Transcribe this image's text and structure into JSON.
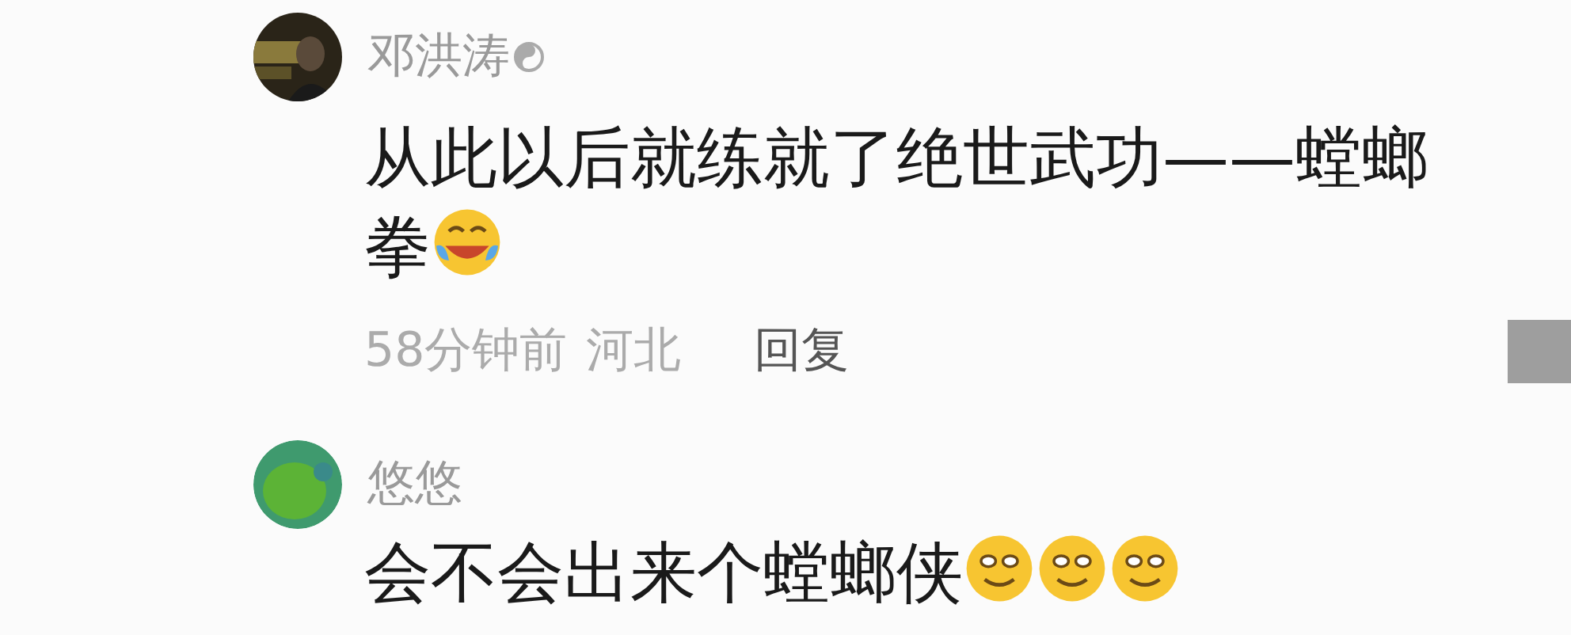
{
  "comments": [
    {
      "name": "邓洪涛",
      "verified": true,
      "avatar": {
        "kind": "picture"
      },
      "text": "从此以后就练就了绝世武功——螳螂拳",
      "emoji": [
        {
          "kind": "laugh-cry"
        }
      ],
      "time": "58分钟前",
      "location": "河北",
      "reply": "回复"
    },
    {
      "name": "悠悠",
      "verified": false,
      "avatar": {
        "kind": "cartoon"
      },
      "text": "会不会出来个螳螂侠",
      "emoji": [
        {
          "kind": "grin"
        },
        {
          "kind": "grin"
        },
        {
          "kind": "grin"
        }
      ]
    }
  ]
}
